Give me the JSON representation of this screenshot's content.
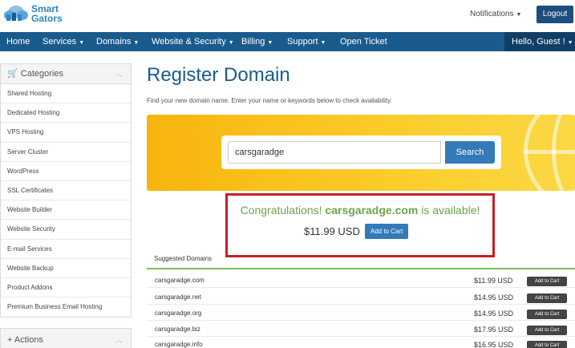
{
  "header": {
    "logo_line1": "Smart",
    "logo_line2": "Gators",
    "notifications_label": "Notifications",
    "logout_label": "Logout"
  },
  "nav": {
    "items": [
      "Home",
      "Services",
      "Domains",
      "Website & Security",
      "Billing",
      "Support",
      "Open Ticket"
    ],
    "greeting": "Hello, Guest !"
  },
  "sidebar": {
    "title": "Categories",
    "items": [
      "Shared Hosting",
      "Dedicated Hosting",
      "VPS Hosting",
      "Server Cluster",
      "WordPress",
      "SSL Certificates",
      "Website Builder",
      "Website Security",
      "E-mail Services",
      "Website Backup",
      "Product Addons",
      "Premium Business Email Hosting"
    ],
    "actions_title": "Actions"
  },
  "main": {
    "title": "Register Domain",
    "subtitle": "Find your new domain name. Enter your name or keywords below to check availability.",
    "search_value": "carsgaradge",
    "search_button": "Search",
    "congrats_prefix": "Congratulations!",
    "congrats_domain": "carsgaradge.com",
    "congrats_suffix": "is available!",
    "price": "$11.99 USD",
    "add_to_cart": "Add to Cart",
    "suggested_title": "Suggested Domains",
    "suggestions": [
      {
        "domain": "carsgaradge.com",
        "price": "$11.99 USD",
        "button": "Add to Cart"
      },
      {
        "domain": "carsgaradge.net",
        "price": "$14.95 USD",
        "button": "Add to Cart"
      },
      {
        "domain": "carsgaradge.org",
        "price": "$14.95 USD",
        "button": "Add to Cart"
      },
      {
        "domain": "carsgaradge.biz",
        "price": "$17.95 USD",
        "button": "Add to Cart"
      },
      {
        "domain": "carsgaradge.info",
        "price": "$16.95 USD",
        "button": "Add to Cart"
      }
    ]
  },
  "colors": {
    "nav_bg": "#1a5b8e",
    "accent_blue": "#337ab7",
    "available_green": "#6aa548",
    "highlight_red": "#c62026"
  }
}
